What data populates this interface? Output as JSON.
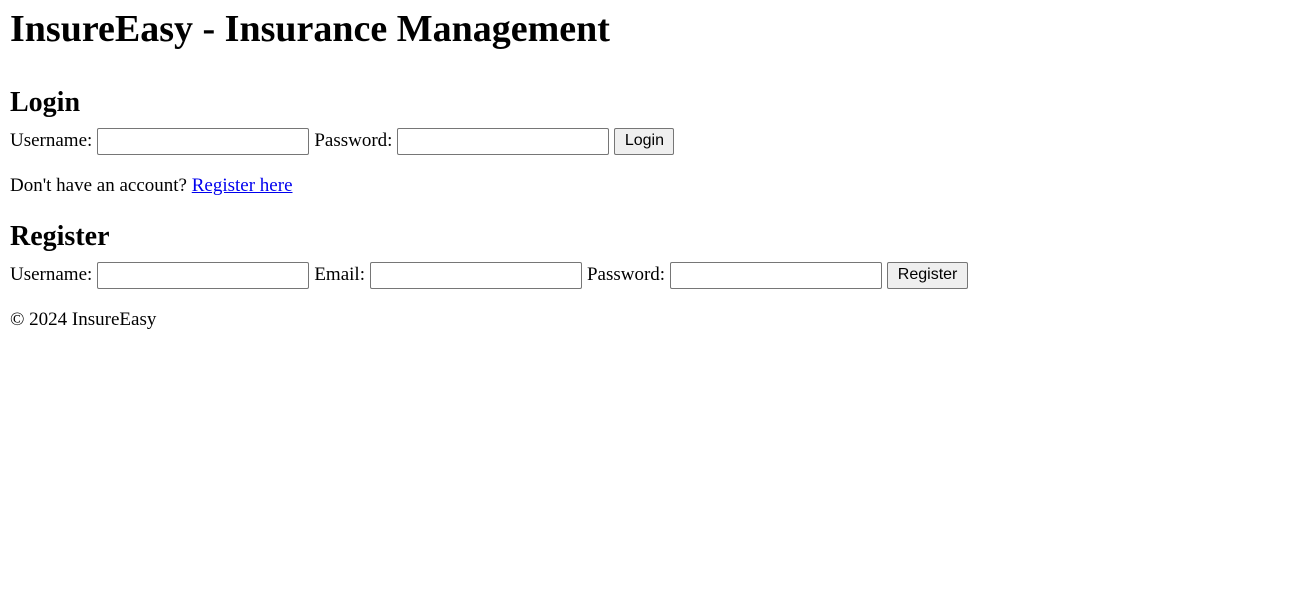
{
  "header": {
    "title": "InsureEasy - Insurance Management"
  },
  "login": {
    "heading": "Login",
    "username_label": "Username:",
    "username_value": "",
    "password_label": "Password:",
    "password_value": "",
    "button_label": "Login",
    "no_account_text": "Don't have an account?",
    "register_link": "Register here"
  },
  "register": {
    "heading": "Register",
    "username_label": "Username:",
    "username_value": "",
    "email_label": "Email:",
    "email_value": "",
    "password_label": "Password:",
    "password_value": "",
    "button_label": "Register"
  },
  "footer": {
    "text": "© 2024 InsureEasy"
  }
}
